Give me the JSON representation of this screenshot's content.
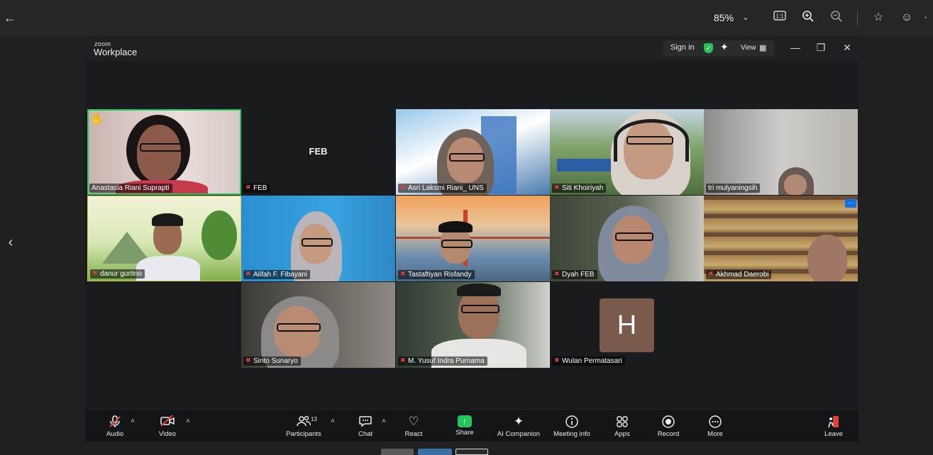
{
  "viewer": {
    "zoom_value": "85%",
    "icons": [
      "back-arrow-icon",
      "chevron-down-icon",
      "actual-size-icon",
      "zoom-in-icon",
      "zoom-out-icon",
      "star-icon",
      "emoji-icon",
      "more-icon",
      "chevron-left-icon"
    ]
  },
  "app": {
    "logo_small": "zoom",
    "logo_big": "Workplace",
    "sign_in": "Sign in",
    "view": "View"
  },
  "participants": [
    {
      "name": "Anastasia Riani Suprapti",
      "active_speaker": true,
      "raised_hand": true,
      "muted": false
    },
    {
      "name": "FEB",
      "display_text": "FEB",
      "muted": true
    },
    {
      "name": "Asri Laksmi Riani_ UNS",
      "muted": true
    },
    {
      "name": "Siti Khoiriyah",
      "muted": true
    },
    {
      "name": "tri mulyaningsih",
      "muted": false
    },
    {
      "name": "danur guritno",
      "muted": true
    },
    {
      "name": "Alifah F. Fibayani",
      "muted": true
    },
    {
      "name": "Tastaftiyan Risfandy",
      "muted": true
    },
    {
      "name": "Dyah FEB",
      "muted": true
    },
    {
      "name": "Akhmad Daerobi",
      "muted": true
    },
    {
      "name": "Sinto Sunaryo",
      "muted": true
    },
    {
      "name": "M. Yusuf Indra Purnama",
      "muted": true
    },
    {
      "name": "Wulan Permatasari",
      "muted": true,
      "avatar_letter": "H"
    }
  ],
  "toolbar": {
    "audio": "Audio",
    "video": "Video",
    "participants": "Participants",
    "participants_count": "13",
    "chat": "Chat",
    "react": "React",
    "share": "Share",
    "ai_companion": "AI Companion",
    "meeting_info": "Meeting info",
    "apps": "Apps",
    "record": "Record",
    "more": "More",
    "leave": "Leave"
  },
  "colors": {
    "active_speaker_border": "#22c55e",
    "share_green": "#22c55e",
    "muted_red": "#e0413a",
    "avatar_bg": "#7a5a4b",
    "more_button_blue": "#0e72ed"
  }
}
